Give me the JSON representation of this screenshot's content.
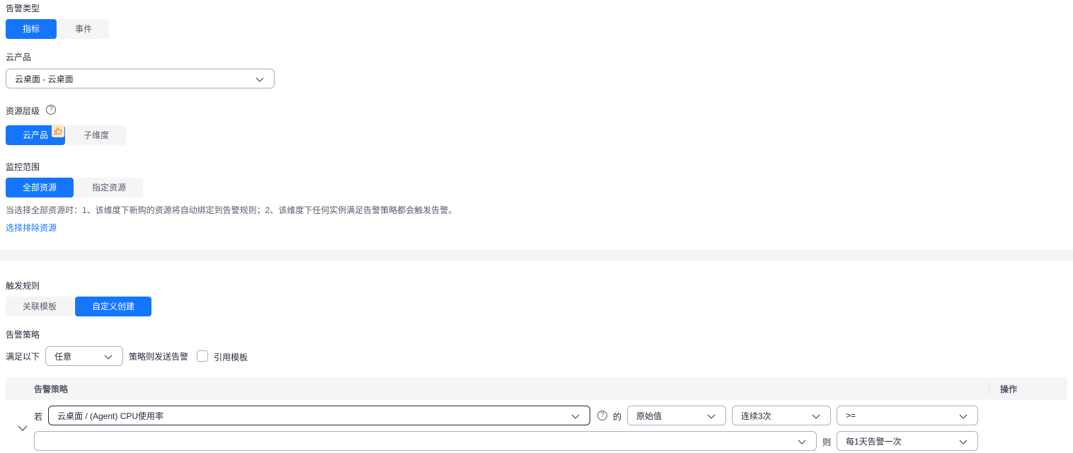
{
  "alarm_type": {
    "label": "告警类型",
    "options": [
      "指标",
      "事件"
    ],
    "selected": "指标"
  },
  "cloud_product": {
    "label": "云产品",
    "value": "云桌面 - 云桌面"
  },
  "resource_level": {
    "label": "资源层级",
    "help": "?",
    "options": [
      "云产品",
      "子维度"
    ],
    "selected": "云产品",
    "recommend_icon": "thumbs-up-icon"
  },
  "monitor_scope": {
    "label": "监控范围",
    "options": [
      "全部资源",
      "指定资源"
    ],
    "selected": "全部资源",
    "hint": "当选择全部资源时：1、该维度下新购的资源将自动绑定到告警规则；2、该维度下任何实例满足告警策略都会触发告警。",
    "exclude_link": "选择排除资源"
  },
  "trigger_rule": {
    "label": "触发规则",
    "options": [
      "关联模板",
      "自定义创建"
    ],
    "selected": "自定义创建"
  },
  "alarm_policy": {
    "label": "告警策略",
    "prefix": "满足以下",
    "condition_value": "任意",
    "suffix": "策略则发送告警",
    "use_template_label": "引用模板",
    "use_template_checked": false
  },
  "policy_table": {
    "columns": [
      "告警策略",
      "操作"
    ],
    "row": {
      "if_label": "若",
      "metric": "云桌面 / (Agent) CPU使用率",
      "help": "?",
      "of_label": "的",
      "stat": "原始值",
      "period": "连续3次",
      "operator": ">=",
      "threshold_value": "",
      "then_label": "则",
      "frequency": "每1天告警一次"
    }
  },
  "colors": {
    "primary": "#1476ff",
    "text": "#252b3a",
    "secondary_text": "#575d6c",
    "segment_bg": "#f5f5f6"
  }
}
